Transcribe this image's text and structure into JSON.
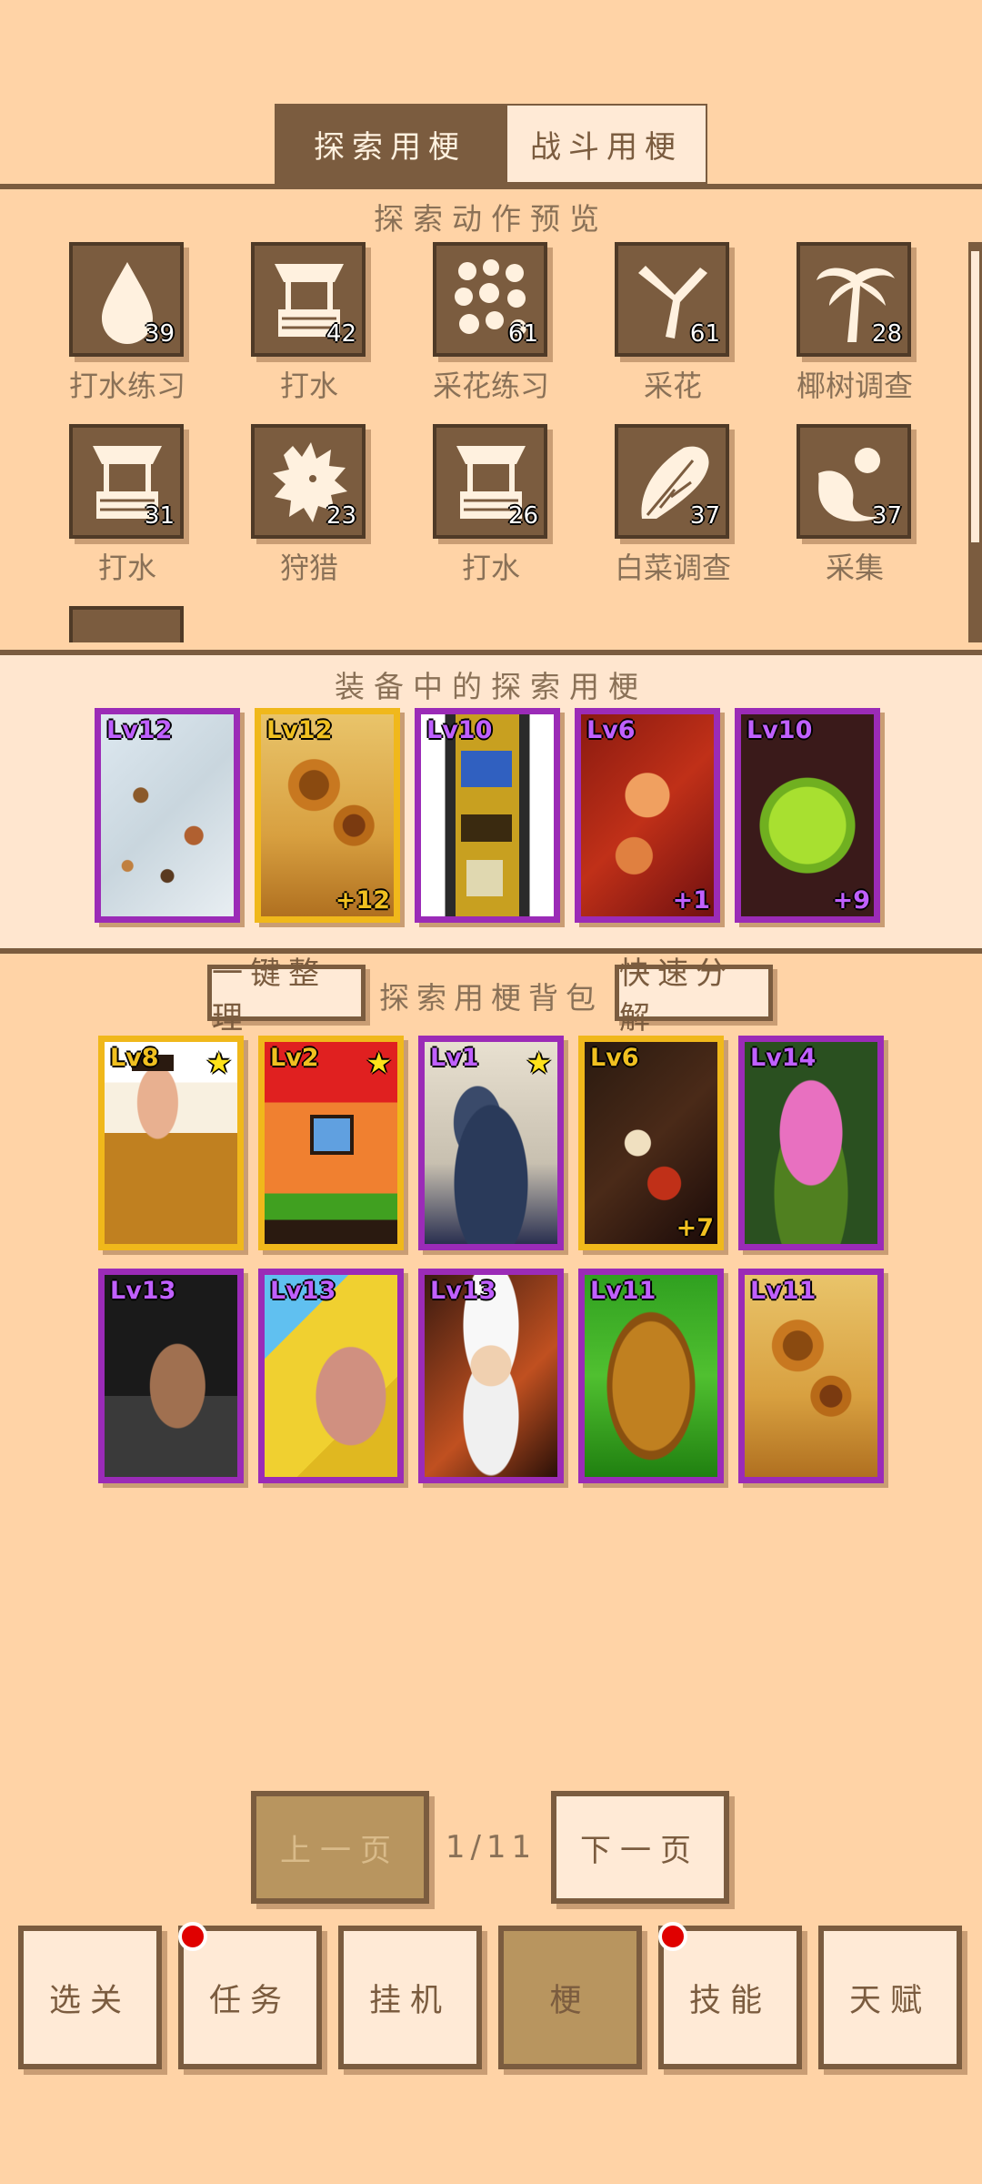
{
  "tabs": [
    {
      "label": "探索用梗",
      "active": true
    },
    {
      "label": "战斗用梗",
      "active": false
    }
  ],
  "preview": {
    "title": "探索动作预览",
    "actions": [
      {
        "label": "打水练习",
        "count": "39",
        "icon": "water-drop-icon"
      },
      {
        "label": "打水",
        "count": "42",
        "icon": "well-icon"
      },
      {
        "label": "采花练习",
        "count": "61",
        "icon": "flowers-icon"
      },
      {
        "label": "采花",
        "count": "61",
        "icon": "pruning-shears-icon"
      },
      {
        "label": "椰树调查",
        "count": "28",
        "icon": "palm-tree-icon"
      },
      {
        "label": "打水",
        "count": "31",
        "icon": "well-icon"
      },
      {
        "label": "狩猎",
        "count": "23",
        "icon": "lion-head-icon"
      },
      {
        "label": "打水",
        "count": "26",
        "icon": "well-icon"
      },
      {
        "label": "白菜调查",
        "count": "37",
        "icon": "cabbage-icon"
      },
      {
        "label": "采集",
        "count": "37",
        "icon": "fruit-bush-icon"
      }
    ]
  },
  "equipped": {
    "title": "装备中的探索用梗",
    "cards": [
      {
        "level": "Lv12",
        "plus": "",
        "rarity": "purple",
        "art": "mosaic-white"
      },
      {
        "level": "Lv12",
        "plus": "+12",
        "rarity": "gold",
        "art": "sunflowers"
      },
      {
        "level": "Lv10",
        "plus": "",
        "rarity": "purple",
        "art": "tall-machine"
      },
      {
        "level": "Lv6",
        "plus": "+1",
        "rarity": "purple",
        "art": "red-figures"
      },
      {
        "level": "Lv10",
        "plus": "+9",
        "rarity": "purple",
        "art": "green-cabbage"
      }
    ]
  },
  "bag": {
    "sort_button": "一键整理",
    "title": "探索用梗背包",
    "decompose_button": "快速分解",
    "cards": [
      {
        "level": "Lv8",
        "plus": "",
        "star": true,
        "rarity": "gold",
        "art": "monk"
      },
      {
        "level": "Lv2",
        "plus": "",
        "star": true,
        "rarity": "gold",
        "art": "house"
      },
      {
        "level": "Lv1",
        "plus": "",
        "star": true,
        "rarity": "purple",
        "art": "great-wave"
      },
      {
        "level": "Lv6",
        "plus": "+7",
        "rarity": "gold",
        "art": "dark-painting"
      },
      {
        "level": "Lv14",
        "plus": "",
        "rarity": "purple",
        "art": "green-monster"
      },
      {
        "level": "Lv13",
        "plus": "",
        "rarity": "purple",
        "art": "dark-hair-person"
      },
      {
        "level": "Lv13",
        "plus": "",
        "rarity": "purple",
        "art": "yellow-creature"
      },
      {
        "level": "Lv13",
        "plus": "",
        "rarity": "purple",
        "art": "old-man"
      },
      {
        "level": "Lv11",
        "plus": "",
        "rarity": "purple",
        "art": "wall-nut"
      },
      {
        "level": "Lv11",
        "plus": "",
        "rarity": "purple",
        "art": "sunflowers"
      }
    ]
  },
  "pagination": {
    "prev": "上一页",
    "indicator": "1/11",
    "next": "下一页"
  },
  "nav": [
    {
      "label": "选关",
      "active": false,
      "badge": false
    },
    {
      "label": "任务",
      "active": false,
      "badge": true
    },
    {
      "label": "挂机",
      "active": false,
      "badge": false
    },
    {
      "label": "梗",
      "active": true,
      "badge": false
    },
    {
      "label": "技能",
      "active": false,
      "badge": true
    },
    {
      "label": "天赋",
      "active": false,
      "badge": false
    }
  ],
  "colors": {
    "background": "#FFD3A6",
    "panel": "#FFE6CF",
    "dark_brown": "#7b5c3f",
    "gold_rarity": "#f0b81b",
    "purple_rarity": "#9b2bb7",
    "badge_red": "#e00000"
  }
}
